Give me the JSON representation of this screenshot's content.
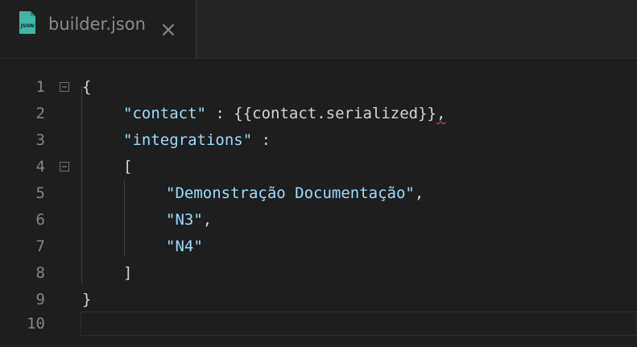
{
  "tab": {
    "icon": "json-file-icon",
    "label": "builder.json",
    "close_icon": "close-icon"
  },
  "editor": {
    "lines": [
      {
        "number": "1",
        "text": "{"
      },
      {
        "number": "2",
        "key": "\"contact\"",
        "sep": " : ",
        "value_open": "{{",
        "value_mid": "contact.serialized",
        "value_close": "}}",
        "trail": ","
      },
      {
        "number": "3",
        "key": "\"integrations\"",
        "sep": " :"
      },
      {
        "number": "4",
        "text": "["
      },
      {
        "number": "5",
        "str": "\"Demonstração Documentação\"",
        "trail": ","
      },
      {
        "number": "6",
        "str": "\"N3\"",
        "trail": ","
      },
      {
        "number": "7",
        "str": "\"N4\""
      },
      {
        "number": "8",
        "text": "]"
      },
      {
        "number": "9",
        "text": "}"
      },
      {
        "number": "10",
        "text": ""
      }
    ]
  },
  "colors": {
    "background": "#1e1e1e",
    "line_number": "#858585",
    "string": "#9cdcfe",
    "text": "#d4d4d4",
    "json_icon": "#3fb6a6"
  }
}
